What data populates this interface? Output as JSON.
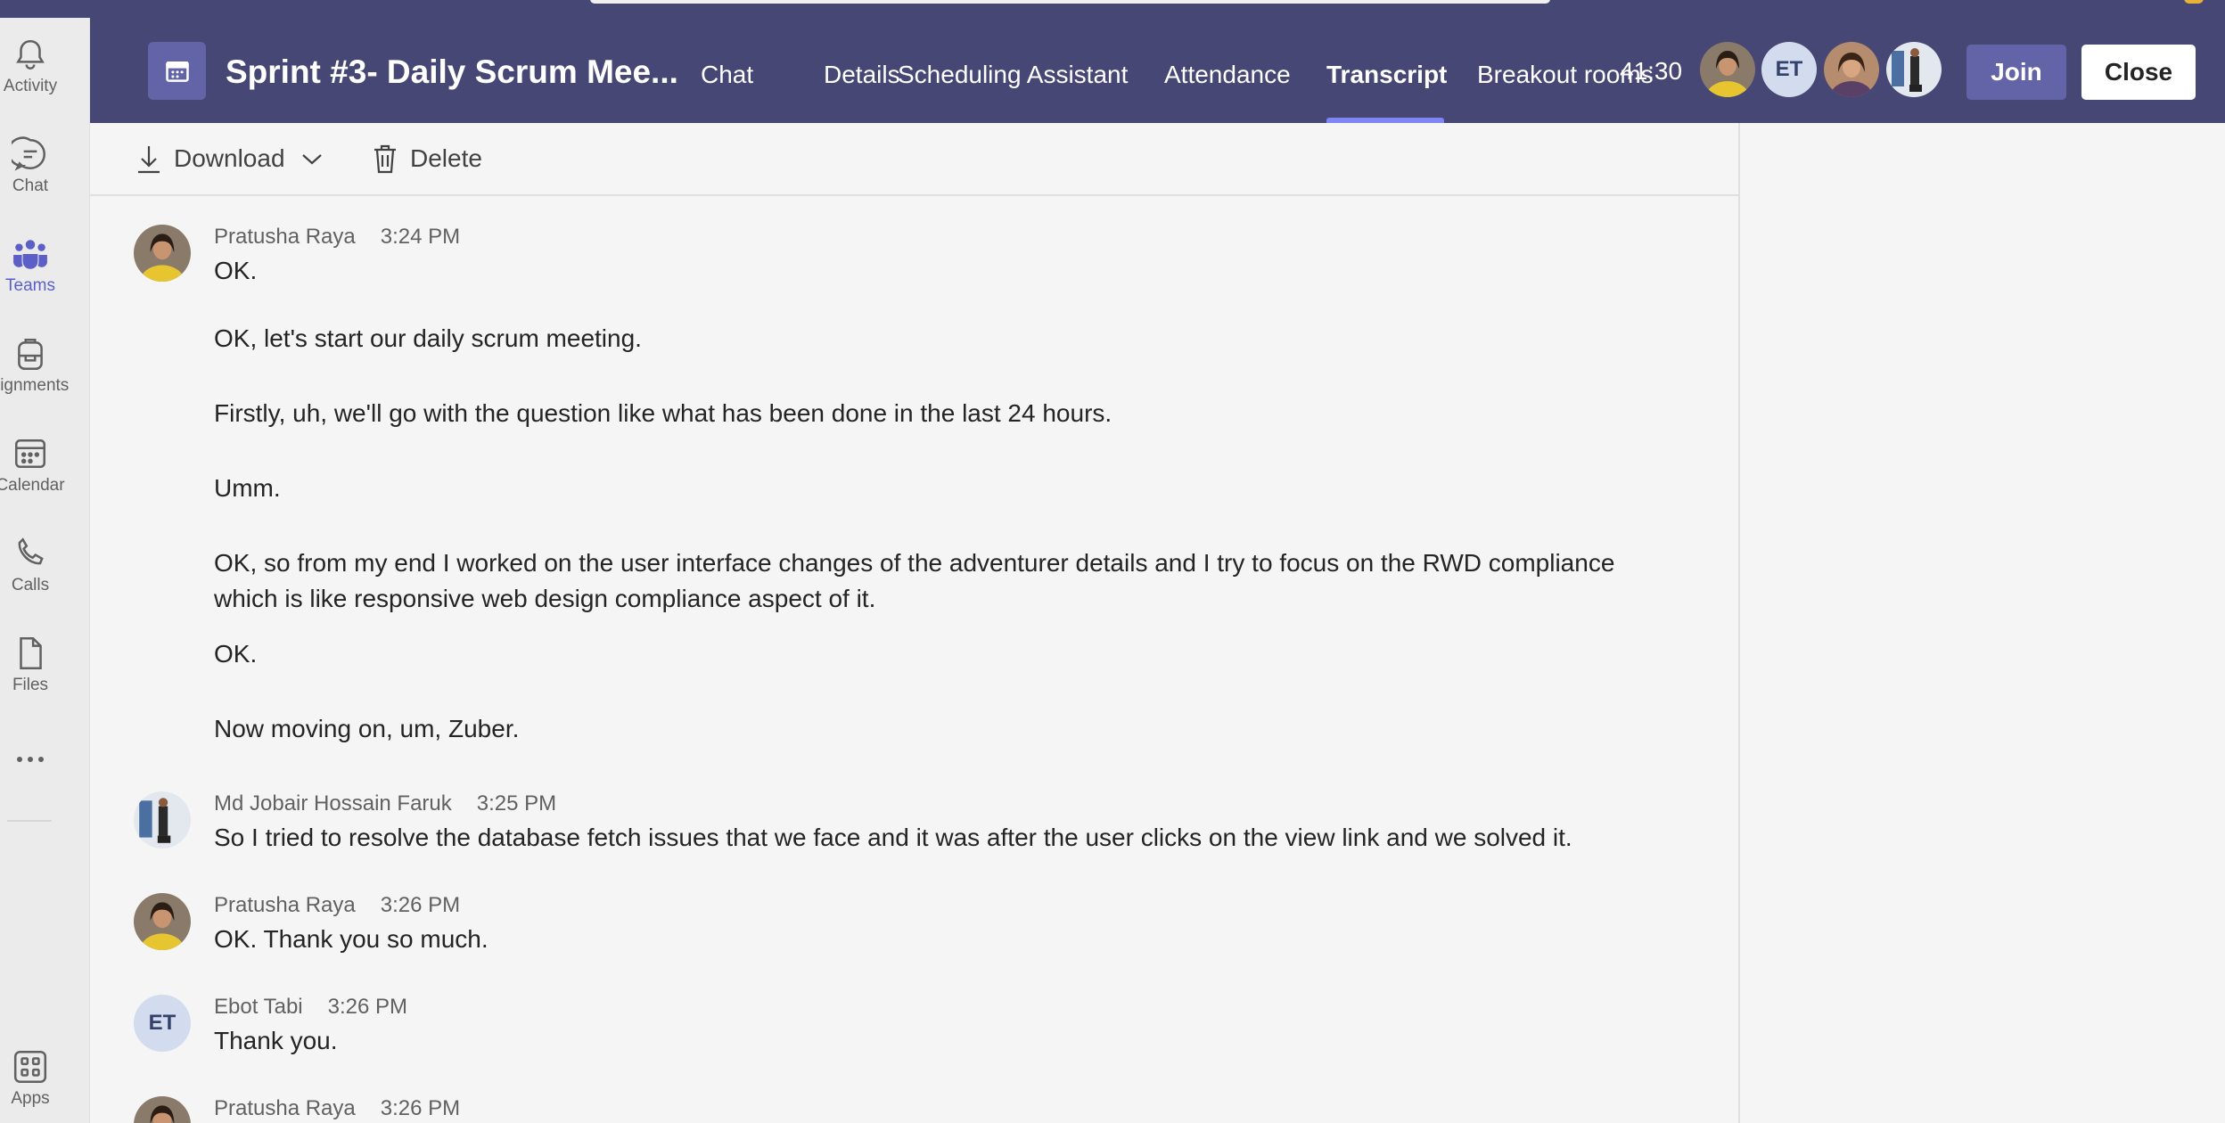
{
  "rail": {
    "activity": "Activity",
    "chat": "Chat",
    "teams": "Teams",
    "assignments": "signments",
    "calendar": "Calendar",
    "calls": "Calls",
    "files": "Files",
    "apps": "Apps"
  },
  "header": {
    "title": "Sprint #3- Daily Scrum Mee...",
    "tabs": [
      "Chat",
      "Details",
      "Scheduling Assistant",
      "Attendance",
      "Transcript",
      "Breakout rooms"
    ],
    "active_tab": "Transcript",
    "timer": "41:30",
    "participant_initials": "ET",
    "join_label": "Join",
    "close_label": "Close"
  },
  "toolbar": {
    "download_label": "Download",
    "delete_label": "Delete"
  },
  "transcript": [
    {
      "speaker": "Pratusha Raya",
      "time": "3:24 PM",
      "avatar": "photo",
      "lines": [
        "OK.",
        "OK, let's start our daily scrum meeting.",
        "Firstly, uh, we'll go with the question like what has been done in the last 24 hours.",
        "Umm.",
        "OK, so from my end I worked on the user interface changes of the adventurer details and I try to focus on the RWD compliance",
        "which is like responsive web design compliance aspect of it.",
        "OK.",
        "Now moving on, um, Zuber."
      ]
    },
    {
      "speaker": "Md Jobair Hossain Faruk",
      "time": "3:25 PM",
      "avatar": "photo",
      "lines": [
        "So I tried to resolve the database fetch issues that we face and it was after the user clicks on the view link and we solved it."
      ]
    },
    {
      "speaker": "Pratusha Raya",
      "time": "3:26 PM",
      "avatar": "photo",
      "lines": [
        "OK. Thank you so much."
      ]
    },
    {
      "speaker": "Ebot Tabi",
      "time": "3:26 PM",
      "avatar": "ET",
      "lines": [
        "Thank you."
      ]
    },
    {
      "speaker": "Pratusha Raya",
      "time": "3:26 PM",
      "avatar": "photo",
      "lines": []
    }
  ],
  "colors": {
    "header_bg": "#464775",
    "accent": "#6264a7",
    "active_tab_underline": "#7f85f5",
    "rail_active": "#5b5fc7"
  }
}
